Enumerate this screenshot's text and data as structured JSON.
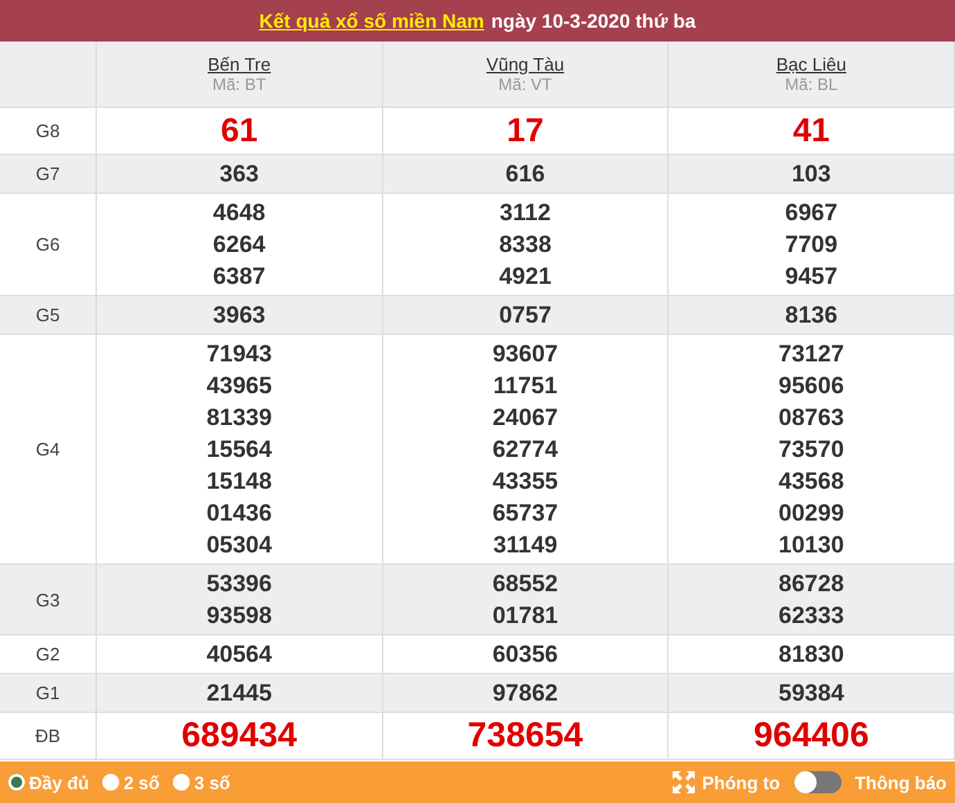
{
  "header": {
    "link": "Kết quả xổ số miền Nam",
    "rest": "ngày 10-3-2020 thứ ba"
  },
  "provinces": [
    {
      "name": "Bến Tre",
      "code": "Mã: BT"
    },
    {
      "name": "Vũng Tàu",
      "code": "Mã: VT"
    },
    {
      "name": "Bạc Liêu",
      "code": "Mã: BL"
    }
  ],
  "rows": [
    {
      "prize": "G8",
      "kind": "red",
      "cells": [
        [
          "61"
        ],
        [
          "17"
        ],
        [
          "41"
        ]
      ]
    },
    {
      "prize": "G7",
      "kind": "normal",
      "cells": [
        [
          "363"
        ],
        [
          "616"
        ],
        [
          "103"
        ]
      ]
    },
    {
      "prize": "G6",
      "kind": "normal",
      "cells": [
        [
          "4648",
          "6264",
          "6387"
        ],
        [
          "3112",
          "8338",
          "4921"
        ],
        [
          "6967",
          "7709",
          "9457"
        ]
      ]
    },
    {
      "prize": "G5",
      "kind": "normal",
      "cells": [
        [
          "3963"
        ],
        [
          "0757"
        ],
        [
          "8136"
        ]
      ]
    },
    {
      "prize": "G4",
      "kind": "normal",
      "cells": [
        [
          "71943",
          "43965",
          "81339",
          "15564",
          "15148",
          "01436",
          "05304"
        ],
        [
          "93607",
          "11751",
          "24067",
          "62774",
          "43355",
          "65737",
          "31149"
        ],
        [
          "73127",
          "95606",
          "08763",
          "73570",
          "43568",
          "00299",
          "10130"
        ]
      ]
    },
    {
      "prize": "G3",
      "kind": "normal",
      "cells": [
        [
          "53396",
          "93598"
        ],
        [
          "68552",
          "01781"
        ],
        [
          "86728",
          "62333"
        ]
      ]
    },
    {
      "prize": "G2",
      "kind": "normal",
      "cells": [
        [
          "40564"
        ],
        [
          "60356"
        ],
        [
          "81830"
        ]
      ]
    },
    {
      "prize": "G1",
      "kind": "normal",
      "cells": [
        [
          "21445"
        ],
        [
          "97862"
        ],
        [
          "59384"
        ]
      ]
    },
    {
      "prize": "ĐB",
      "kind": "special",
      "cells": [
        [
          "689434"
        ],
        [
          "738654"
        ],
        [
          "964406"
        ]
      ]
    }
  ],
  "footer": {
    "options": [
      {
        "label": "Đầy đủ",
        "selected": true
      },
      {
        "label": "2 số",
        "selected": false
      },
      {
        "label": "3 số",
        "selected": false
      }
    ],
    "zoom": "Phóng to",
    "notify": {
      "label": "Thông báo",
      "on": false
    }
  }
}
